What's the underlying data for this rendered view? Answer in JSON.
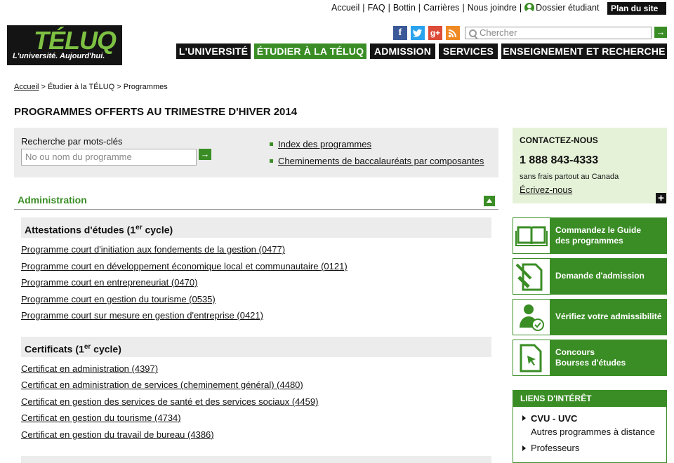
{
  "util": {
    "links": [
      "Accueil",
      "FAQ",
      "Bottin",
      "Carrières",
      "Nous joindre"
    ],
    "dossier": "Dossier étudiant",
    "plan": "Plan du site"
  },
  "logo": {
    "name": "TÉLUQ",
    "tagline": "L'université. Aujourd'hui."
  },
  "social": [
    "f",
    "t",
    "g+",
    "rss"
  ],
  "search": {
    "placeholder": "Chercher"
  },
  "nav": [
    "L'UNIVERSITÉ",
    "ÉTUDIER À LA TÉLUQ",
    "ADMISSION",
    "SERVICES",
    "ENSEIGNEMENT ET RECHERCHE"
  ],
  "breadcrumb": {
    "home": "Accueil",
    "level2": "Étudier à la TÉLUQ",
    "current": "Programmes",
    "sep": ">"
  },
  "page_title": "PROGRAMMES OFFERTS AU TRIMESTRE D'HIVER 2014",
  "keyword_search": {
    "label": "Recherche par mots-clés",
    "placeholder": "No ou nom du programme",
    "links": [
      "Index des programmes",
      "Cheminements de baccalauréats par composantes"
    ]
  },
  "section": {
    "title": "Administration"
  },
  "groups": [
    {
      "title_a": "Attestations d'études (1",
      "title_sup": "er",
      "title_b": " cycle)",
      "items": [
        "Programme court d'initiation aux fondements de la gestion (0477)",
        "Programme court en développement économique local et communautaire (0121)",
        "Programme court en entrepreneuriat (0470)",
        "Programme court en gestion du tourisme (0535)",
        "Programme court sur mesure en gestion d'entreprise (0421)"
      ]
    },
    {
      "title_a": "Certificats (1",
      "title_sup": "er",
      "title_b": " cycle)",
      "items": [
        "Certificat en administration (4397)",
        "Certificat en administration de services (cheminement général) (4480)",
        "Certificat en gestion des services de santé et des services sociaux (4459)",
        "Certificat en gestion du tourisme (4734)",
        "Certificat en gestion du travail de bureau (4386)"
      ]
    }
  ],
  "contact": {
    "heading": "CONTACTEZ-NOUS",
    "phone": "1 888 843-4333",
    "note": "sans frais partout au Canada",
    "write": "Écrivez-nous"
  },
  "tiles": [
    {
      "line1": "Commandez le Guide",
      "line2": "des programmes",
      "icon": "book-icon"
    },
    {
      "line1": "Demande d'admission",
      "line2": "",
      "icon": "form-pencil-icon"
    },
    {
      "line1": "Vérifiez votre admissibilité",
      "line2": "",
      "icon": "user-check-icon"
    },
    {
      "line1": "Concours",
      "line2": "Bourses d'études",
      "icon": "document-cursor-icon"
    }
  ],
  "liens": {
    "heading": "LIENS D'INTÉRÊT",
    "items": [
      {
        "title": "CVU - UVC",
        "sub": "Autres programmes à distance"
      },
      {
        "title": "Professeurs",
        "sub": ""
      }
    ]
  },
  "colors": {
    "green": "#3a8d25",
    "dark": "#141414",
    "light_gray": "#ececec",
    "light_green": "#e5f2d8"
  }
}
